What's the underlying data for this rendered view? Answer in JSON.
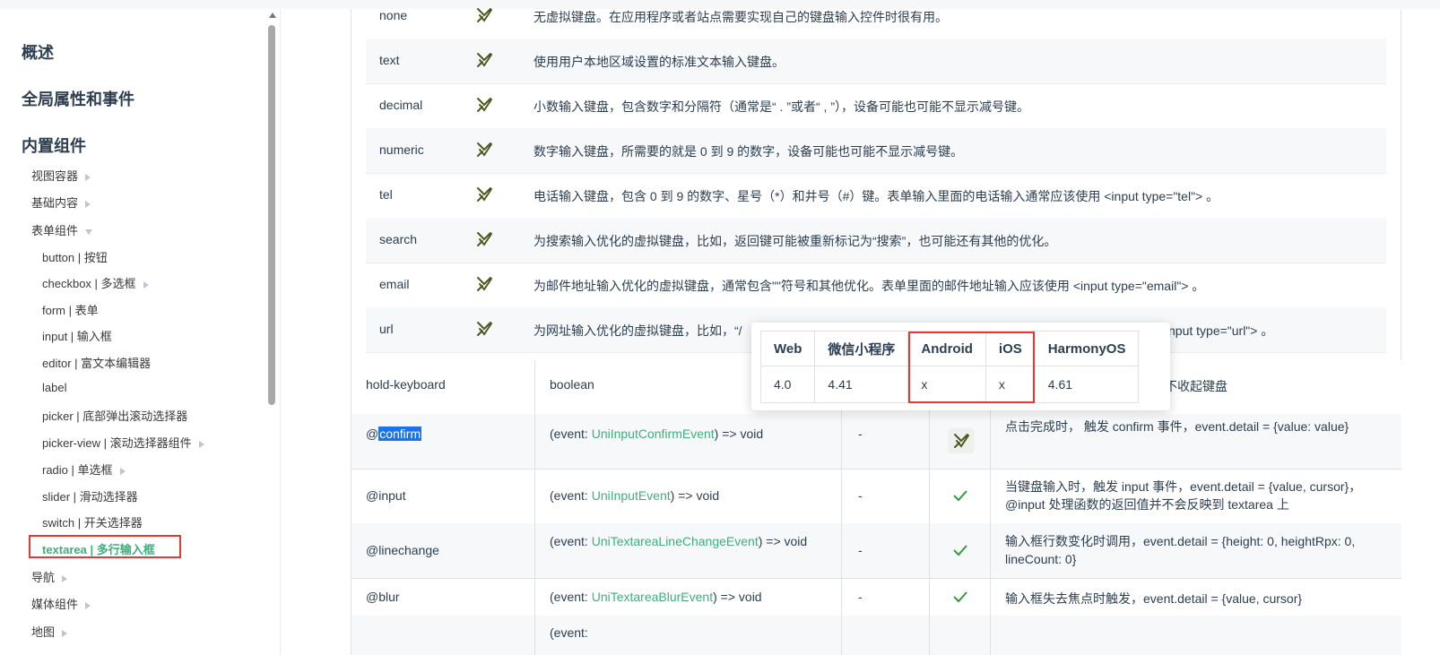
{
  "sidebar": {
    "headings": [
      "概述",
      "全局属性和事件",
      "内置组件"
    ],
    "items": [
      {
        "label": "视图容器",
        "arrow": "right",
        "level": 1
      },
      {
        "label": "基础内容",
        "arrow": "right",
        "level": 1
      },
      {
        "label": "表单组件",
        "arrow": "down",
        "level": 1
      },
      {
        "label": "button | 按钮",
        "arrow": "",
        "level": 2
      },
      {
        "label": "checkbox | 多选框",
        "arrow": "right",
        "level": 2
      },
      {
        "label": "form | 表单",
        "arrow": "",
        "level": 2
      },
      {
        "label": "input | 输入框",
        "arrow": "",
        "level": 2
      },
      {
        "label": "editor | 富文本编辑器",
        "arrow": "",
        "level": 2
      },
      {
        "label": "label",
        "arrow": "",
        "level": 2
      },
      {
        "label": "picker | 底部弹出滚动选择器",
        "arrow": "",
        "level": 2
      },
      {
        "label": "picker-view | 滚动选择器组件",
        "arrow": "right",
        "level": 2
      },
      {
        "label": "radio | 单选框",
        "arrow": "right",
        "level": 2
      },
      {
        "label": "slider | 滑动选择器",
        "arrow": "",
        "level": 2
      },
      {
        "label": "switch | 开关选择器",
        "arrow": "",
        "level": 2
      }
    ],
    "active": "textarea | 多行输入框",
    "after": [
      {
        "label": "导航",
        "arrow": "right"
      },
      {
        "label": "媒体组件",
        "arrow": "right"
      },
      {
        "label": "地图",
        "arrow": "right"
      }
    ]
  },
  "inputmode_rows": [
    {
      "name": "none",
      "desc": "无虚拟键盘。在应用程序或者站点需要实现自己的键盘输入控件时很有用。"
    },
    {
      "name": "text",
      "desc": "使用用户本地区域设置的标准文本输入键盘。"
    },
    {
      "name": "decimal",
      "desc": "小数输入键盘，包含数字和分隔符（通常是“ . ”或者“ , ”），设备可能也可能不显示减号键。"
    },
    {
      "name": "numeric",
      "desc": "数字输入键盘，所需要的就是 0 到 9 的数字，设备可能也可能不显示减号键。"
    },
    {
      "name": "tel",
      "desc": "电话输入键盘，包含 0 到 9 的数字、星号（*）和井号（#）键。表单输入里面的电话输入通常应该使用 <input type=\"tel\"> 。"
    },
    {
      "name": "search",
      "desc": "为搜索输入优化的虚拟键盘，比如，返回键可能被重新标记为“搜索”，也可能还有其他的优化。"
    },
    {
      "name": "email",
      "desc": "为邮件地址输入优化的虚拟键盘，通常包含\"\"符号和其他优化。表单里面的邮件地址输入应该使用 <input type=\"email\"> 。"
    },
    {
      "name": "url",
      "desc_left": "为网址输入优化的虚拟键盘，比如，“/",
      "desc_right": "nput type=\"url\"> 。"
    }
  ],
  "rows": [
    {
      "name_prefix": "",
      "name": "hold-keyboard",
      "type_prefix": "boolean",
      "type_link": "",
      "type_suffix": "",
      "default": "",
      "desc": "不收起键盘"
    },
    {
      "name_prefix": "@",
      "name": "confirm",
      "type_prefix": "(event: ",
      "type_link": "UniInputConfirmEvent",
      "type_suffix": ") => void",
      "default": "-",
      "desc": "点击完成时， 触发 confirm 事件，event.detail = {value: value}"
    },
    {
      "name_prefix": "@",
      "name": "input",
      "type_prefix": "(event: ",
      "type_link": "UniInputEvent",
      "type_suffix": ") => void",
      "default": "-",
      "desc": "当键盘输入时，触发 input 事件，event.detail = {value, cursor}， @input 处理函数的返回值并不会反映到 textarea 上"
    },
    {
      "name_prefix": "@",
      "name": "linechange",
      "type_prefix": "(event: ",
      "type_link": "UniTextareaLineChangeEvent",
      "type_suffix": ") => void",
      "default": "-",
      "desc": "输入框行数变化时调用，event.detail = {height: 0, heightRpx: 0, lineCount: 0}"
    },
    {
      "name_prefix": "@",
      "name": "blur",
      "type_prefix": "(event: ",
      "type_link": "UniTextareaBlurEvent",
      "type_suffix": ") => void",
      "default": "-",
      "desc": "输入框失去焦点时触发，event.detail = {value, cursor}"
    },
    {
      "name_prefix": "",
      "name": "",
      "type_prefix": "(event:",
      "type_link": "",
      "type_suffix": "",
      "default": "",
      "desc": ""
    }
  ],
  "popup": {
    "headers": [
      "Web",
      "微信小程序",
      "Android",
      "iOS",
      "HarmonyOS"
    ],
    "values": [
      "4.0",
      "4.41",
      "x",
      "x",
      "4.61"
    ]
  },
  "colors": {
    "link": "#3eaf7c",
    "highlight": "#e53935",
    "check_dark": "#4a5a1e",
    "check_green": "#2e9d3e"
  }
}
